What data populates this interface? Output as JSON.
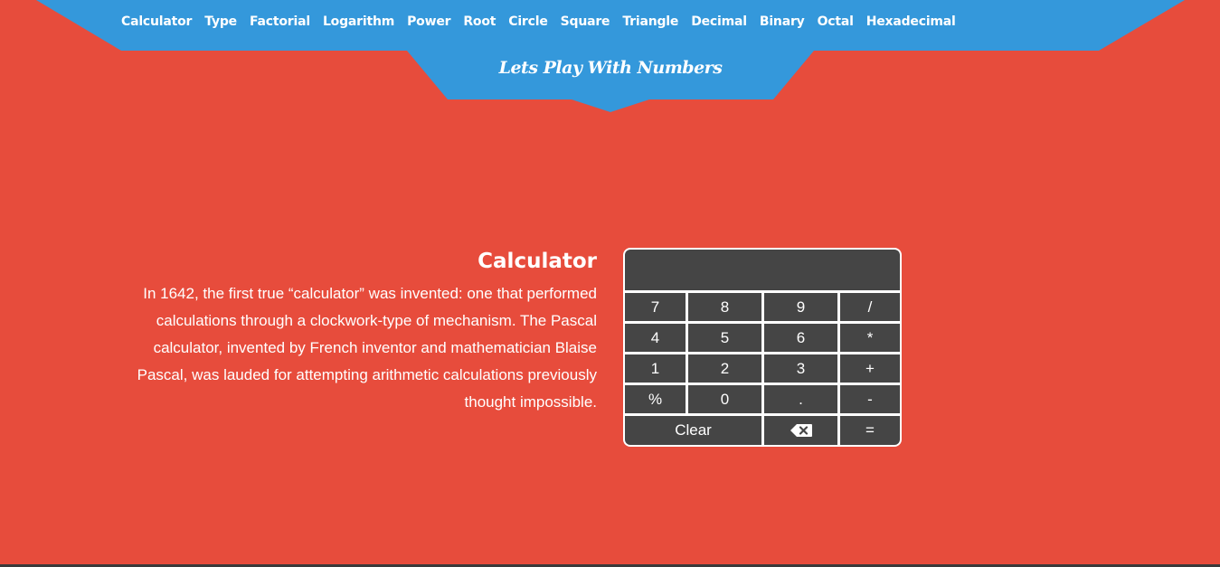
{
  "nav": {
    "links": [
      "Calculator",
      "Type",
      "Factorial",
      "Logarithm",
      "Power",
      "Root",
      "Circle",
      "Square",
      "Triangle",
      "Decimal",
      "Binary",
      "Octal",
      "Hexadecimal"
    ]
  },
  "header": {
    "tagline": "Lets Play With Numbers"
  },
  "info": {
    "title": "Calculator",
    "text": "In 1642, the first true “calculator” was invented: one that performed calculations through a clockwork-type of mechanism. The Pascal calculator, invented by French inventor and mathematician Blaise Pascal, was lauded for attempting arithmetic calculations previously thought impossible."
  },
  "calculator": {
    "display": "",
    "keys": {
      "k7": "7",
      "k8": "8",
      "k9": "9",
      "div": "/",
      "k4": "4",
      "k5": "5",
      "k6": "6",
      "mul": "*",
      "k1": "1",
      "k2": "2",
      "k3": "3",
      "add": "+",
      "pct": "%",
      "k0": "0",
      "dot": ".",
      "sub": "-",
      "clear": "Clear",
      "backspace_icon": "backspace-icon",
      "equals": "="
    }
  },
  "colors": {
    "background": "#e74c3c",
    "nav": "#3498db",
    "calculator": "#454545"
  }
}
